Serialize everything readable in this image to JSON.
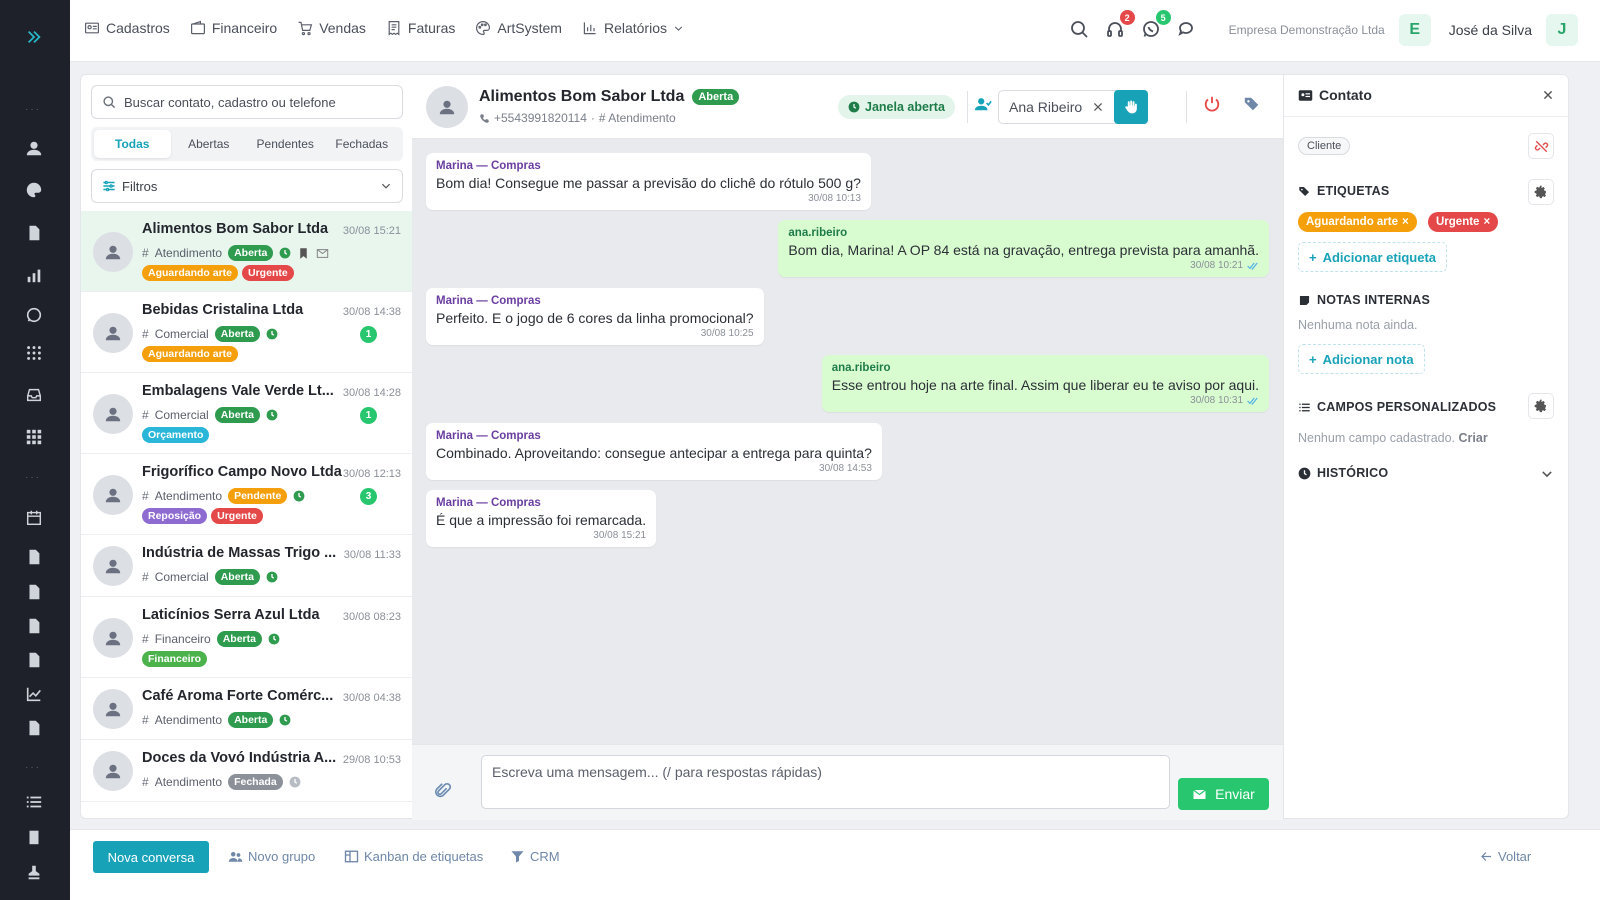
{
  "topnav": {
    "items": [
      {
        "label": "Cadastros",
        "icon": "address-card-icon"
      },
      {
        "label": "Financeiro",
        "icon": "wallet-icon"
      },
      {
        "label": "Vendas",
        "icon": "cart-icon"
      },
      {
        "label": "Faturas",
        "icon": "receipt-icon"
      },
      {
        "label": "ArtSystem",
        "icon": "palette-icon"
      },
      {
        "label": "Relatórios",
        "icon": "bar-chart-icon"
      }
    ],
    "headset_badge": "2",
    "whatsapp_badge": "5",
    "company": "Empresa Demonstração Ltda",
    "company_initial": "E",
    "user": "José da Silva",
    "user_initial": "J"
  },
  "list": {
    "search_placeholder": "Buscar contato, cadastro ou telefone",
    "tabs": [
      "Todas",
      "Abertas",
      "Pendentes",
      "Fechadas"
    ],
    "filters_label": "Filtros",
    "conversations": [
      {
        "name": "Alimentos Bom Sabor Ltda",
        "time": "30/08 15:21",
        "queue": "Atendimento",
        "status": "Aberta",
        "tags": [
          "Aguardando arte",
          "Urgente"
        ],
        "count": ""
      },
      {
        "name": "Bebidas Cristalina Ltda",
        "time": "30/08 14:38",
        "queue": "Comercial",
        "status": "Aberta",
        "tags": [
          "Aguardando arte"
        ],
        "count": "1"
      },
      {
        "name": "Embalagens Vale Verde Lt...",
        "time": "30/08 14:28",
        "queue": "Comercial",
        "status": "Aberta",
        "tags": [
          "Orçamento"
        ],
        "count": "1"
      },
      {
        "name": "Frigorífico Campo Novo Ltda",
        "time": "30/08 12:13",
        "queue": "Atendimento",
        "status": "Pendente",
        "tags": [
          "Reposição",
          "Urgente"
        ],
        "count": "3"
      },
      {
        "name": "Indústria de Massas Trigo ...",
        "time": "30/08 11:33",
        "queue": "Comercial",
        "status": "Aberta",
        "tags": [],
        "count": ""
      },
      {
        "name": "Laticínios Serra Azul Ltda",
        "time": "30/08 08:23",
        "queue": "Financeiro",
        "status": "Aberta",
        "tags": [
          "Financeiro"
        ],
        "count": ""
      },
      {
        "name": "Café Aroma Forte Comérc...",
        "time": "30/08 04:38",
        "queue": "Atendimento",
        "status": "Aberta",
        "tags": [],
        "count": ""
      },
      {
        "name": "Doces da Vovó Indústria A...",
        "time": "29/08 10:53",
        "queue": "Atendimento",
        "status": "Fechada",
        "tags": [],
        "count": ""
      }
    ]
  },
  "colors": {
    "accent": "#17a2b8",
    "green": "#28a745",
    "aberta": "#2e9b4f",
    "pendente": "#f59f0b",
    "fechada": "#8c9099",
    "urgente": "#e54848",
    "aguardando": "#f59f0b",
    "orcamento": "#29b6d9",
    "reposicao": "#8e6bd1",
    "financeiro": "#4cb24c"
  },
  "chat": {
    "contact_name": "Alimentos Bom Sabor Ltda",
    "status": "Aberta",
    "phone": "+5543991820114",
    "queue": "# Atendimento",
    "window_label": "Janela aberta",
    "assignee": "Ana Ribeiro",
    "messages": [
      {
        "from": "Marina — Compras",
        "dir": "in",
        "text": "Bom dia! Consegue me passar a previsão do clichê do rótulo 500 g?",
        "time": "30/08 10:13"
      },
      {
        "from": "ana.ribeiro",
        "dir": "out",
        "text": "Bom dia, Marina! A OP 84 está na gravação, entrega prevista para amanhã.",
        "time": "30/08 10:21"
      },
      {
        "from": "Marina — Compras",
        "dir": "in",
        "text": "Perfeito. E o jogo de 6 cores da linha promocional?",
        "time": "30/08 10:25"
      },
      {
        "from": "ana.ribeiro",
        "dir": "out",
        "text": "Esse entrou hoje na arte final. Assim que liberar eu te aviso por aqui.",
        "time": "30/08 10:31"
      },
      {
        "from": "Marina — Compras",
        "dir": "in",
        "text": "Combinado. Aproveitando: consegue antecipar a entrega para quinta?",
        "time": "30/08 14:53"
      },
      {
        "from": "Marina — Compras",
        "dir": "in",
        "text": "É que a impressão foi remarcada.",
        "time": "30/08 15:21"
      }
    ],
    "composer_placeholder": "Escreva uma mensagem... (/ para respostas rápidas)",
    "send_label": "Enviar"
  },
  "contact_panel": {
    "title": "Contato",
    "type_badge": "Cliente",
    "tags_title": "ETIQUETAS",
    "tags": [
      "Aguardando arte",
      "Urgente"
    ],
    "add_tag": "Adicionar etiqueta",
    "notes_title": "NOTAS INTERNAS",
    "notes_empty": "Nenhuma nota ainda.",
    "add_note": "Adicionar nota",
    "fields_title": "CAMPOS PERSONALIZADOS",
    "fields_empty": "Nenhum campo cadastrado.",
    "fields_create": "Criar",
    "history_title": "HISTÓRICO"
  },
  "bottom": {
    "new_conversation": "Nova conversa",
    "new_group": "Novo grupo",
    "kanban": "Kanban de etiquetas",
    "crm": "CRM",
    "back": "Voltar"
  }
}
